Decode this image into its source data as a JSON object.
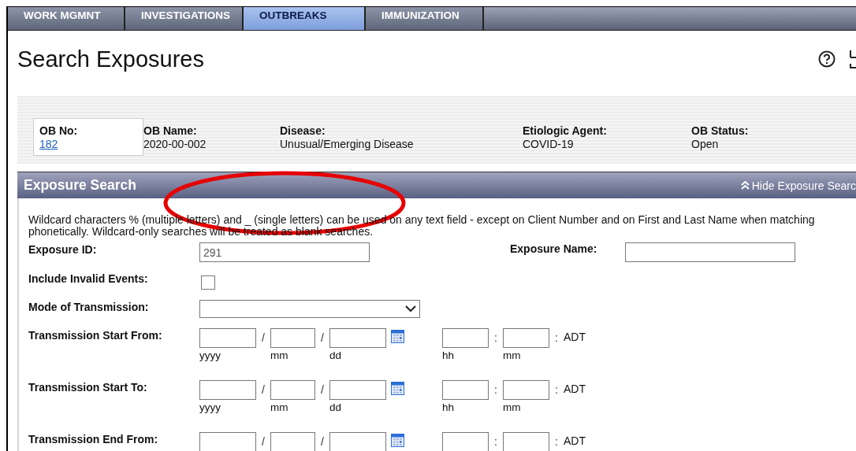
{
  "tabs": [
    {
      "label": "WORK MGMNT",
      "selected": false
    },
    {
      "label": "INVESTIGATIONS",
      "selected": false
    },
    {
      "label": "OUTBREAKS",
      "selected": true
    },
    {
      "label": "IMMUNIZATION",
      "selected": false
    }
  ],
  "title": "Search Exposures",
  "outbreak": [
    {
      "label": "OB No:",
      "value": "182",
      "kind": "link"
    },
    {
      "label": "OB Name:",
      "value": "2020-00-002",
      "kind": "text"
    },
    {
      "label": "Disease:",
      "value": "Unusual/Emerging Disease",
      "kind": "text"
    },
    {
      "label": "Etiologic Agent:",
      "value": "COVID-19",
      "kind": "text"
    },
    {
      "label": "OB Status:",
      "value": "Open",
      "kind": "text"
    }
  ],
  "section": {
    "title": "Exposure Search",
    "toggle": "Hide Exposure Searc"
  },
  "notice": "Wildcard characters % (multiple letters) and _ (single letters) can be used on any text field - except on Client Number and on First and Last Name when matching phonetically. Wildcard-only searches will be treated as blank searches.",
  "rows": [
    {
      "kind": "text",
      "label": "Exposure ID:",
      "value": "291",
      "extra": {
        "label": "Exposure Name:"
      }
    },
    {
      "kind": "checkbox",
      "label": "Include Invalid Events:",
      "checked": false
    },
    {
      "kind": "select",
      "label": "Mode of Transmission:"
    },
    {
      "kind": "datetime",
      "label": "Transmission Start From:",
      "date_sep": "/",
      "time_sep": ":",
      "zone": "ADT",
      "date_parts": [
        "yyyy",
        "mm",
        "dd"
      ],
      "time_parts": [
        "hh",
        "mm"
      ]
    },
    {
      "kind": "datetime",
      "label": "Transmission Start To:",
      "date_sep": "/",
      "time_sep": ":",
      "zone": "ADT",
      "date_parts": [
        "yyyy",
        "mm",
        "dd"
      ],
      "time_parts": [
        "hh",
        "mm"
      ]
    },
    {
      "kind": "datetime",
      "label": "Transmission End From:",
      "date_sep": "/",
      "time_sep": ":",
      "zone": "ADT"
    }
  ],
  "annotation": {
    "kind": "ellipse",
    "color": "#e60000"
  }
}
